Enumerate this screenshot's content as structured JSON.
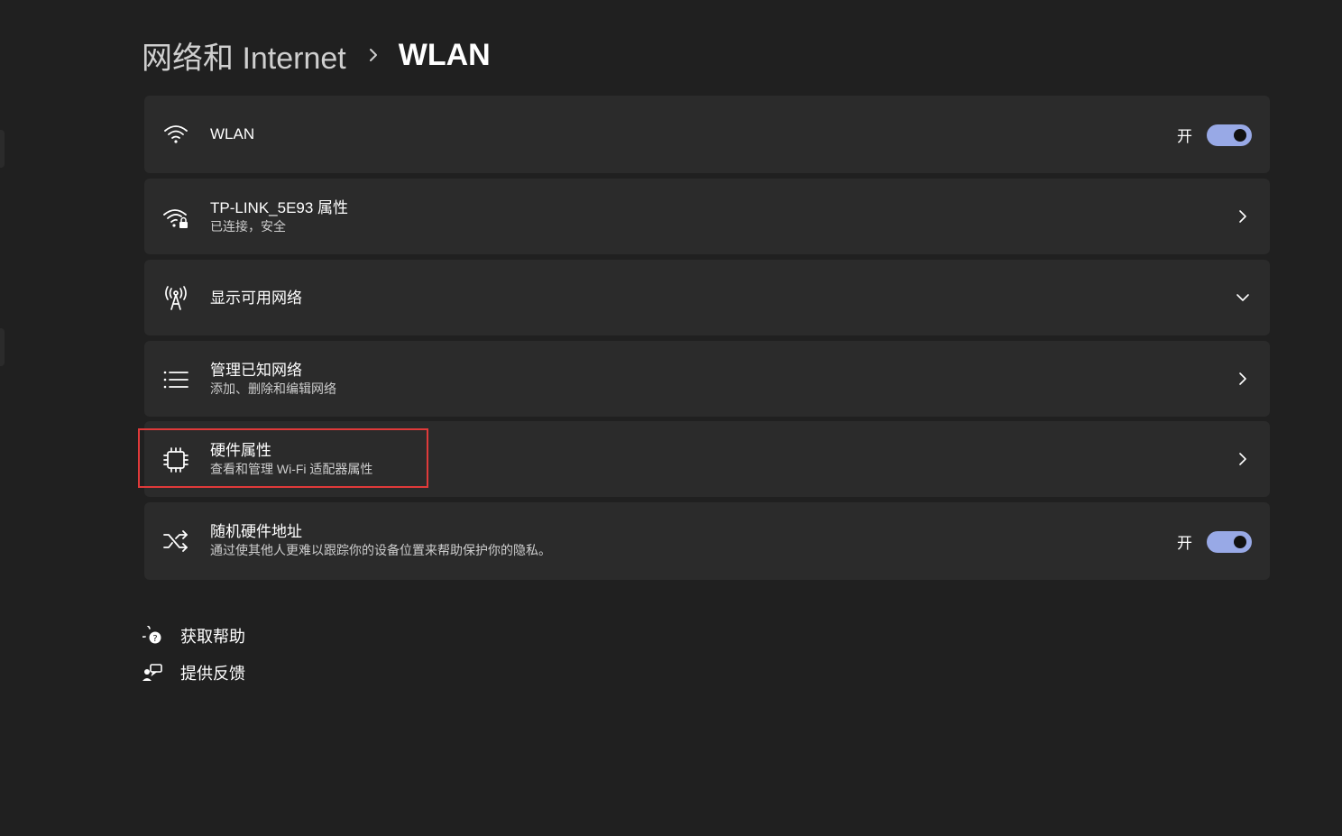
{
  "breadcrumb": {
    "parent": "网络和 Internet",
    "separator_icon": "chevron-right-icon",
    "current": "WLAN"
  },
  "cards": {
    "wlan": {
      "icon": "wifi-icon",
      "title": "WLAN",
      "toggle_label": "开",
      "toggle_on": true
    },
    "network_properties": {
      "icon": "wifi-lock-icon",
      "title": "TP-LINK_5E93 属性",
      "subtitle": "已连接，安全"
    },
    "show_available": {
      "icon": "antenna-icon",
      "title": "显示可用网络"
    },
    "manage_known": {
      "icon": "list-icon",
      "title": "管理已知网络",
      "subtitle": "添加、删除和编辑网络"
    },
    "hardware_properties": {
      "icon": "chip-icon",
      "title": "硬件属性",
      "subtitle": "查看和管理 Wi-Fi 适配器属性"
    },
    "random_mac": {
      "icon": "shuffle-icon",
      "title": "随机硬件地址",
      "subtitle": "通过使其他人更难以跟踪你的设备位置来帮助保护你的隐私。",
      "toggle_label": "开",
      "toggle_on": true
    }
  },
  "footer_links": {
    "help": {
      "icon": "help-chat-icon",
      "label": "获取帮助"
    },
    "feedback": {
      "icon": "feedback-icon",
      "label": "提供反馈"
    }
  },
  "colors": {
    "background": "#202020",
    "card": "#2b2b2b",
    "accent": "#98a9e6",
    "highlight": "#e03a3a"
  }
}
